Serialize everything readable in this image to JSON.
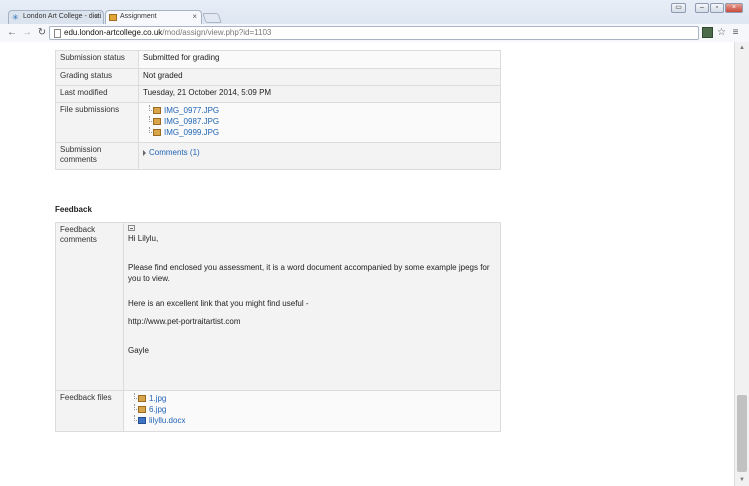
{
  "browser": {
    "tabs": [
      {
        "label": "London Art College - dicti",
        "active": false
      },
      {
        "label": "Assignment",
        "active": true
      }
    ],
    "url_host": "edu.london-artcollege.co.uk",
    "url_path": "/mod/assign/view.php?id=1103"
  },
  "submission": {
    "rows": [
      {
        "label": "Submission status",
        "value": "Submitted for grading"
      },
      {
        "label": "Grading status",
        "value": "Not graded"
      },
      {
        "label": "Last modified",
        "value": "Tuesday, 21 October 2014, 5:09 PM"
      }
    ],
    "files_label": "File submissions",
    "files": [
      "IMG_0977.JPG",
      "IMG_0987.JPG",
      "IMG_0999.JPG"
    ],
    "comments_label_line1": "Submission",
    "comments_label_line2": "comments",
    "comments_link": "Comments (1)"
  },
  "feedback": {
    "heading": "Feedback",
    "comments_label_line1": "Feedback",
    "comments_label_line2": "comments",
    "greeting": "Hi Lilylu,",
    "para1": "Please find enclosed you assessment, it is a word document accompanied by some example jpegs for you to view.",
    "para2": "Here is an excellent link that you might find useful -",
    "link": "http://www.pet-portraitartist.com",
    "signoff": "Gayle",
    "files_label": "Feedback files",
    "files": [
      "1.jpg",
      "6.jpg",
      "lilyllu.docx"
    ]
  },
  "colors": {
    "status_submitted_bg": "#cfefcf",
    "link": "#1f63b5"
  },
  "icons": {
    "back": "back-arrow-icon",
    "forward": "forward-arrow-icon",
    "reload": "reload-icon",
    "menu": "menu-icon",
    "star": "star-icon"
  }
}
